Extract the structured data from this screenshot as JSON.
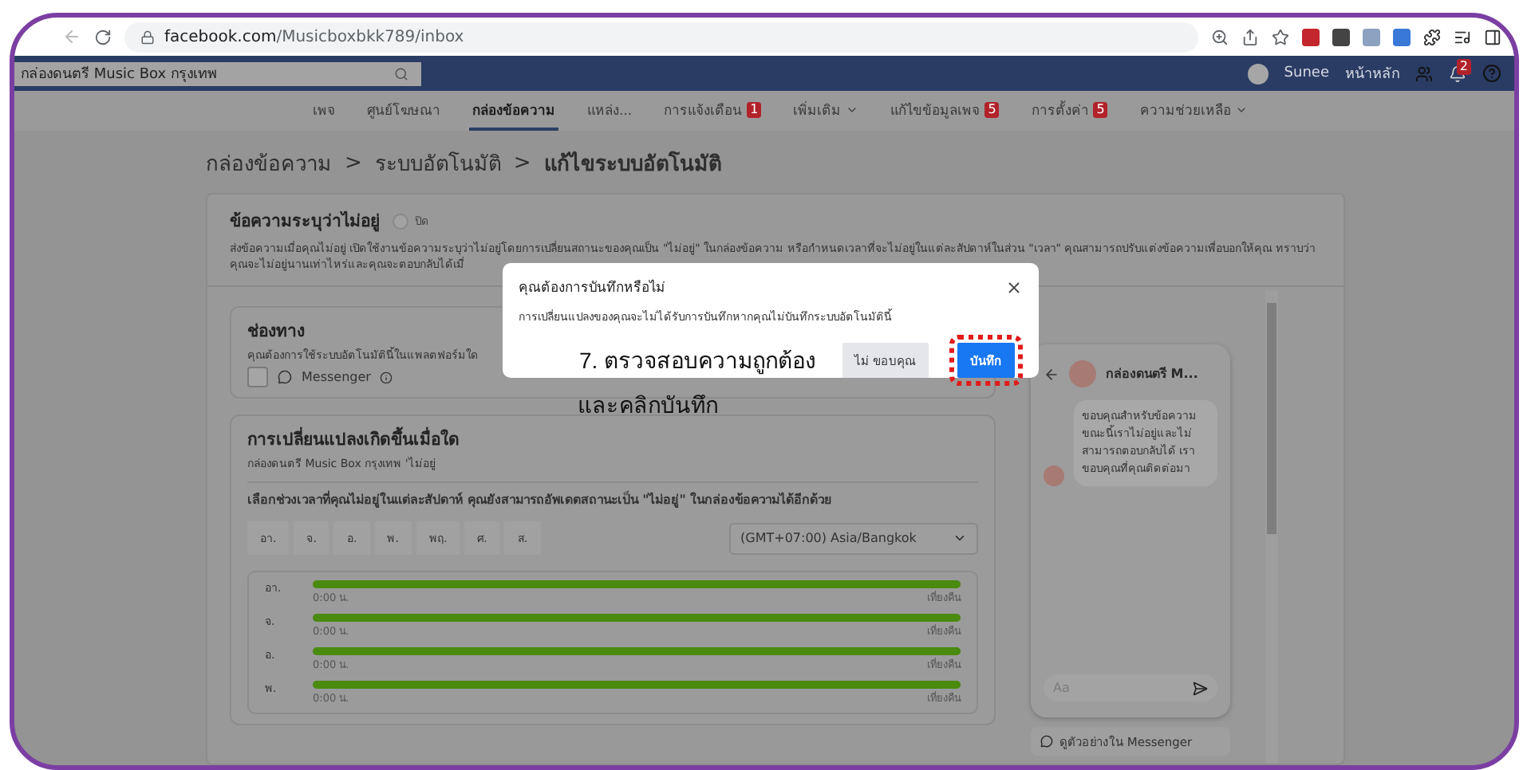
{
  "browser": {
    "url_host": "facebook.com",
    "url_path": "/Musicboxbkk789/inbox"
  },
  "topbar": {
    "search_value": "กล่องดนตรี Music Box กรุงเทพ",
    "user": "Sunee",
    "home": "หน้าหลัก",
    "notification_count": "2"
  },
  "nav": [
    {
      "label": "เพจ",
      "selected": false
    },
    {
      "label": "ศูนย์โฆษณา",
      "selected": false
    },
    {
      "label": "กล่องข้อความ",
      "selected": true
    },
    {
      "label": "แหล่ง...",
      "selected": false
    },
    {
      "label": "การแจ้งเตือน",
      "selected": false,
      "badge": "1"
    },
    {
      "label": "เพิ่มเติม",
      "selected": false,
      "dropdown": true
    },
    {
      "label": "แก้ไขข้อมูลเพจ",
      "selected": false,
      "badge": "5"
    },
    {
      "label": "การตั้งค่า",
      "selected": false,
      "badge": "5"
    },
    {
      "label": "ความช่วยเหลือ",
      "selected": false,
      "dropdown": true
    }
  ],
  "breadcrumb": {
    "items": [
      "กล่องข้อความ",
      "ระบบอัตโนมัติ",
      "แก้ไขระบบอัตโนมัติ"
    ],
    "separator": ">"
  },
  "away": {
    "title": "ข้อความระบุว่าไม่อยู่",
    "toggle_label": "ปิด",
    "toggle_on": false,
    "description": "ส่งข้อความเมื่อคุณไม่อยู่ เปิดใช้งานข้อความระบุว่าไม่อยู่โดยการเปลี่ยนสถานะของคุณเป็น \"ไม่อยู่\" ในกล่องข้อความ หรือกำหนดเวลาที่จะไม่อยู่ในแต่ละสัปดาห์ในส่วน \"เวลา\" คุณสามารถปรับแต่งข้อความเพื่อบอกให้คุณ ทราบว่าคุณจะไม่อยู่นานเท่าไหร่และคุณจะตอบกลับได้เมื่"
  },
  "channel": {
    "title": "ช่องทาง",
    "subtitle": "คุณต้องการใช้ระบบอัตโนมัตินี้ในแพลตฟอร์มใด",
    "option": "Messenger",
    "checked": false
  },
  "trigger": {
    "title": "การเปลี่ยนแปลงเกิดขึ้นเมื่อใด",
    "subtitle": "กล่องดนตรี Music Box กรุงเทพ 'ไม่อยู่",
    "instruction": "เลือกช่วงเวลาที่คุณไม่อยู่ในแต่ละสัปดาห์ คุณยังสามารถอัพเดตสถานะเป็น \"ไม่อยู่\" ในกล่องข้อความได้อีกด้วย",
    "days": [
      {
        "label": "อา.",
        "selected": false
      },
      {
        "label": "จ.",
        "selected": false
      },
      {
        "label": "อ.",
        "selected": false
      },
      {
        "label": "พ.",
        "selected": false
      },
      {
        "label": "พฤ.",
        "selected": false
      },
      {
        "label": "ศ.",
        "selected": false
      },
      {
        "label": "ส.",
        "selected": false
      }
    ],
    "timezone": "(GMT+07:00) Asia/Bangkok",
    "schedule": [
      {
        "day": "อา.",
        "start": "0:00 น.",
        "end": "เที่ยงคืน",
        "level": 1
      },
      {
        "day": "จ.",
        "start": "0:00 น.",
        "end": "เที่ยงคืน",
        "level": 1
      },
      {
        "day": "อ.",
        "start": "0:00 น.",
        "end": "เที่ยงคืน",
        "level": 1
      },
      {
        "day": "พ.",
        "start": "0:00 น.",
        "end": "เที่ยงคืน",
        "level": 1
      }
    ]
  },
  "preview": {
    "page_name": "กล่องดนตรี M...",
    "message": "ขอบคุณสำหรับข้อความ ขณะนี้เราไม่อยู่และไม่สามารถตอบกลับได้ เรา ขอบคุณที่คุณติดต่อมา",
    "composer_placeholder": "Aa",
    "link": "ดูตัวอย่างใน Messenger"
  },
  "dialog": {
    "title": "คุณต้องการบันทึกหรือไม่",
    "body": "การเปลี่ยนแปลงของคุณจะไม่ได้รับการบันทึกหากคุณไม่บันทึกระบบอัตโนมัตินี้",
    "buttons": [
      {
        "label": "ไม่ ขอบคุณ",
        "kind": "secondary",
        "highlighted": false
      },
      {
        "label": "บันทึก",
        "kind": "primary",
        "highlighted": true
      }
    ]
  },
  "annotation": {
    "line_1": "7. ตรวจสอบความถูกต้อง",
    "line_2": "และคลิกบันทึก"
  }
}
